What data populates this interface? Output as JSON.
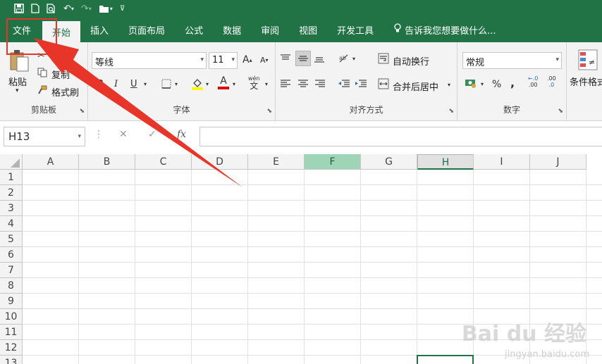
{
  "qat": {
    "save_icon": "save-icon",
    "new_icon": "new-file-icon",
    "preview_icon": "print-preview-icon",
    "undo_icon": "undo-icon",
    "redo_icon": "redo-icon",
    "open_icon": "open-folder-icon",
    "customize_icon": "customize-qat-icon"
  },
  "tabs": [
    {
      "label": "文件"
    },
    {
      "label": "开始"
    },
    {
      "label": "插入"
    },
    {
      "label": "页面布局"
    },
    {
      "label": "公式"
    },
    {
      "label": "数据"
    },
    {
      "label": "审阅"
    },
    {
      "label": "视图"
    },
    {
      "label": "开发工具"
    },
    {
      "label": "告诉我您想要做什么..."
    }
  ],
  "ribbon": {
    "clipboard": {
      "label": "剪贴板",
      "paste": "粘贴",
      "cut": "剪切",
      "copy": "复制",
      "format_painter": "格式刷"
    },
    "font": {
      "label": "字体",
      "font_name": "等线",
      "font_size": "11",
      "grow": "A",
      "shrink": "A",
      "bold": "B",
      "italic": "I",
      "underline": "U",
      "font_color": "A",
      "phonetic": "wén"
    },
    "alignment": {
      "label": "对齐方式",
      "wrap": "自动换行",
      "merge": "合并后居中"
    },
    "number": {
      "label": "数字",
      "format": "常规",
      "percent": "%",
      "comma": ",",
      "inc_decimal": ".00",
      "dec_decimal": ".0"
    },
    "styles": {
      "conditional": "条件格式"
    }
  },
  "formula_bar": {
    "name_box": "H13",
    "cancel": "✕",
    "enter": "✓",
    "fx": "fx",
    "value": ""
  },
  "grid": {
    "columns": [
      "A",
      "B",
      "C",
      "D",
      "E",
      "F",
      "G",
      "H",
      "I",
      "J"
    ],
    "rows": [
      "1",
      "2",
      "3",
      "4",
      "5",
      "6",
      "7",
      "8",
      "9",
      "10",
      "11",
      "12",
      "13"
    ],
    "active_cell": "H13"
  },
  "watermark": {
    "brand": "Bai du 经验",
    "url": "jingyan.baidu.com"
  },
  "colors": {
    "accent": "#217346",
    "highlight_col": "#9fd5b7",
    "annotation": "#e8352a"
  }
}
